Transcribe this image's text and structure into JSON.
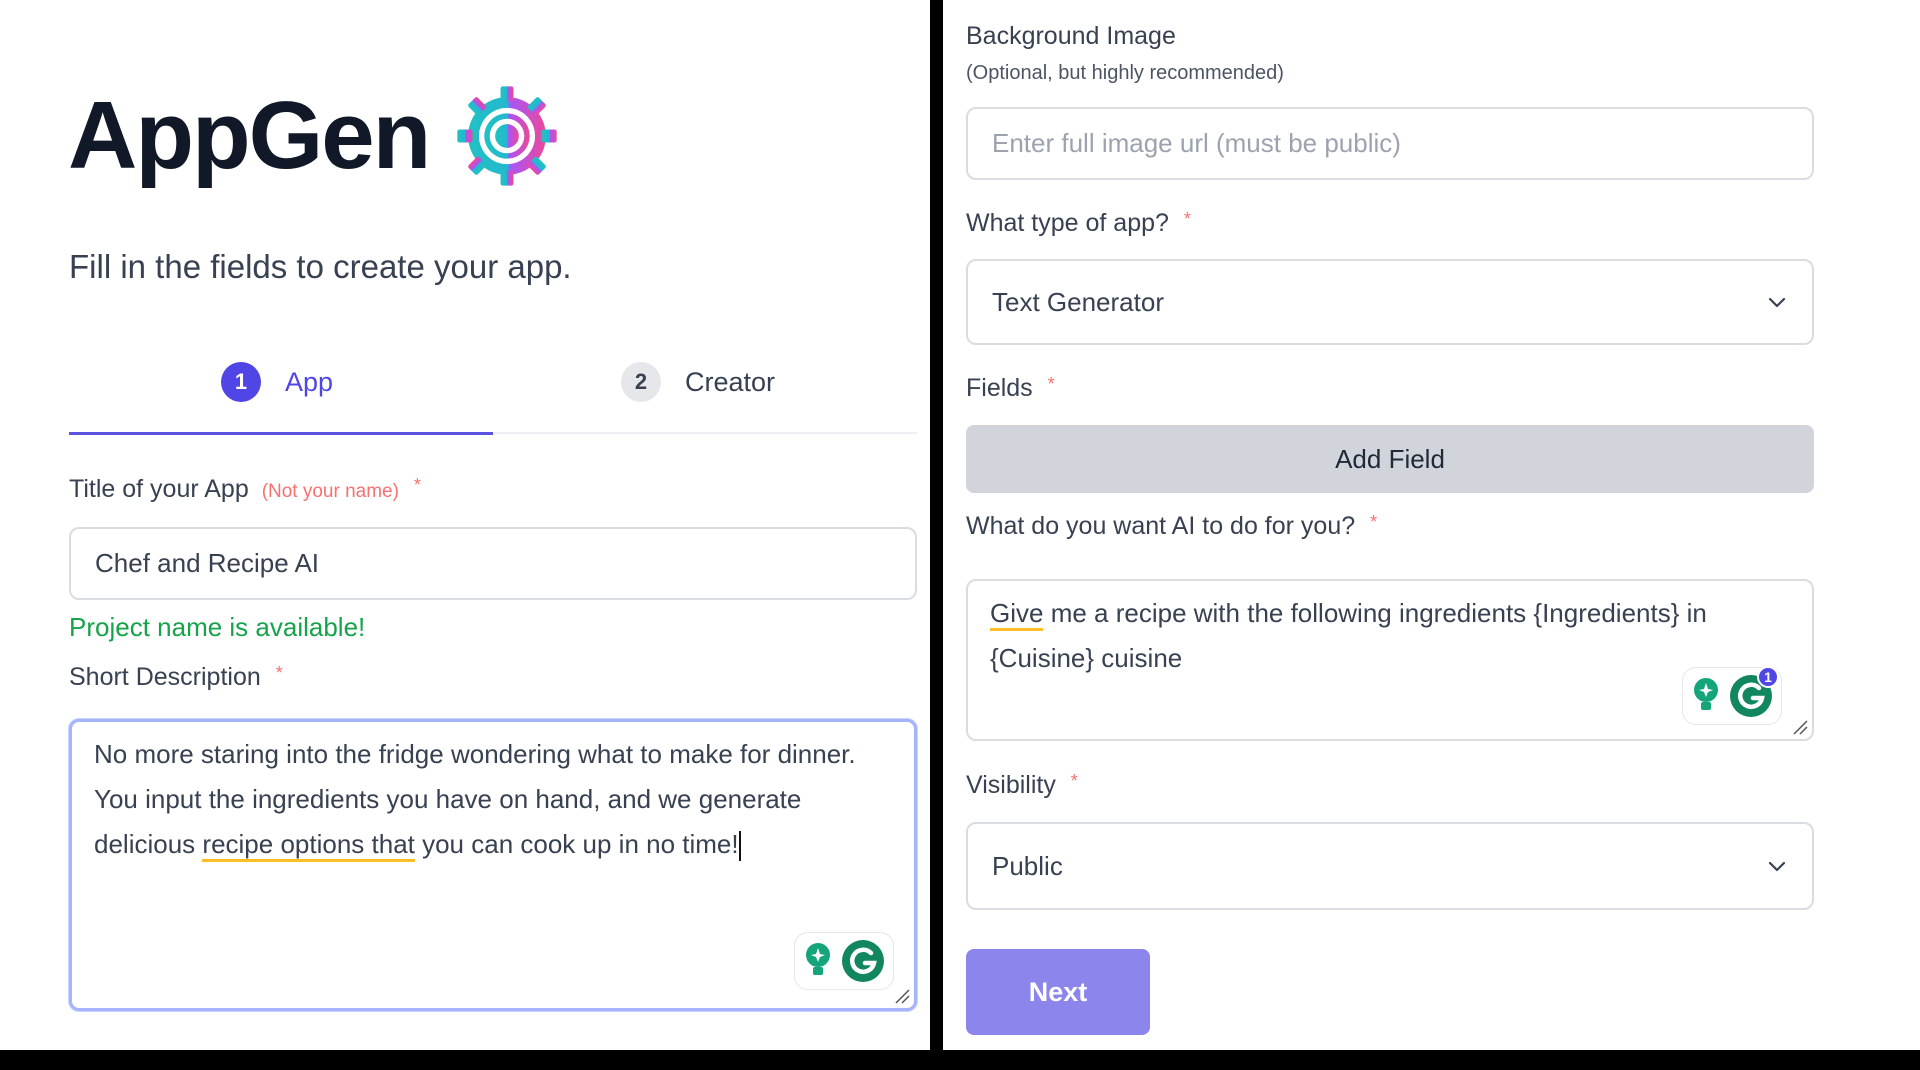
{
  "brand": {
    "name": "AppGen",
    "logo_icon": "gear-target-logo"
  },
  "subtitle": "Fill in the fields to create your app.",
  "steps": [
    {
      "number": "1",
      "label": "App",
      "active": true
    },
    {
      "number": "2",
      "label": "Creator",
      "active": false
    }
  ],
  "form_left": {
    "title_label": "Title of your App",
    "title_hint": "(Not your name)",
    "required_mark": "*",
    "title_value": "Chef and Recipe AI",
    "title_status": "Project name is available!",
    "description_label": "Short Description",
    "description_value_before": "No more staring into the fridge wondering what to make for dinner. You input the ingredients you have on hand, and we generate delicious ",
    "description_value_flagged": "recipe options that",
    "description_value_after": " you can cook up in no time!"
  },
  "form_right": {
    "bg_image_label": "Background Image",
    "bg_image_sublabel": "(Optional, but highly recommended)",
    "bg_image_placeholder": "Enter full image url (must be public)",
    "bg_image_value": "",
    "app_type_label": "What type of app?",
    "app_type_value": "Text Generator",
    "fields_label": "Fields",
    "add_field_button": "Add Field",
    "prompt_label": "What do you want AI to do for you?",
    "prompt_value_flagged": "Give",
    "prompt_value_rest": " me a recipe with the following ingredients {Ingredients} in {Cuisine} cuisine",
    "grammarly_badge_count": "1",
    "visibility_label": "Visibility",
    "visibility_value": "Public",
    "next_button": "Next",
    "required_mark": "*"
  },
  "colors": {
    "accent": "#4f46e5",
    "success": "#16a34a",
    "required": "#f87171",
    "next_button": "#8b85ec",
    "grammarly_green": "#15a57a"
  }
}
